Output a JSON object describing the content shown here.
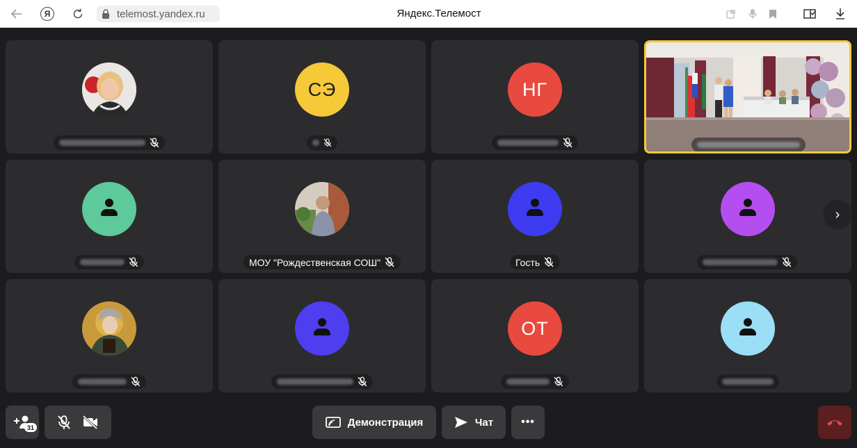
{
  "browser": {
    "url": "telemost.yandex.ru",
    "title": "Яндекс.Телемост",
    "icons": [
      "back-arrow-icon",
      "yandex-logo-icon",
      "reload-icon",
      "lock-icon",
      "picture-in-picture-icon",
      "microphone-icon",
      "bookmark-icon",
      "reader-icon",
      "download-icon"
    ]
  },
  "participants": [
    {
      "name": "",
      "avatar_type": "photo",
      "muted": true
    },
    {
      "name": "",
      "initials": "СЭ",
      "avatar_color": "#f5c938",
      "muted": true
    },
    {
      "name": "",
      "initials": "НГ",
      "avatar_color": "#e84a3f",
      "muted": true
    },
    {
      "name": "",
      "avatar_type": "video",
      "speaking": true,
      "muted": false
    },
    {
      "name": "",
      "avatar_color": "#5ec99a",
      "avatar_type": "generic",
      "muted": true
    },
    {
      "name": "МОУ \"Рождественская СОШ\"",
      "avatar_type": "photo",
      "muted": true
    },
    {
      "name": "Гость",
      "avatar_color": "#3d3cf0",
      "avatar_type": "generic",
      "muted": true
    },
    {
      "name": "",
      "avatar_color": "#b54ef0",
      "avatar_type": "generic",
      "muted": true
    },
    {
      "name": "",
      "avatar_type": "photo",
      "muted": true
    },
    {
      "name": "",
      "avatar_color": "#4e3ef0",
      "avatar_type": "generic",
      "muted": true
    },
    {
      "name": "",
      "initials": "ОТ",
      "avatar_color": "#e84a3f",
      "muted": true
    },
    {
      "name": "",
      "avatar_color": "#9adff5",
      "avatar_type": "generic",
      "muted": false
    }
  ],
  "controls": {
    "participants_count": "31",
    "demo_label": "Демонстрация",
    "chat_label": "Чат",
    "more_label": "•••"
  },
  "colors": {
    "background": "#1c1c1e",
    "tile": "#2c2c2e",
    "speaking_border": "#f5c938",
    "hangup": "#5b1f20",
    "hangup_icon": "#e0474c"
  }
}
